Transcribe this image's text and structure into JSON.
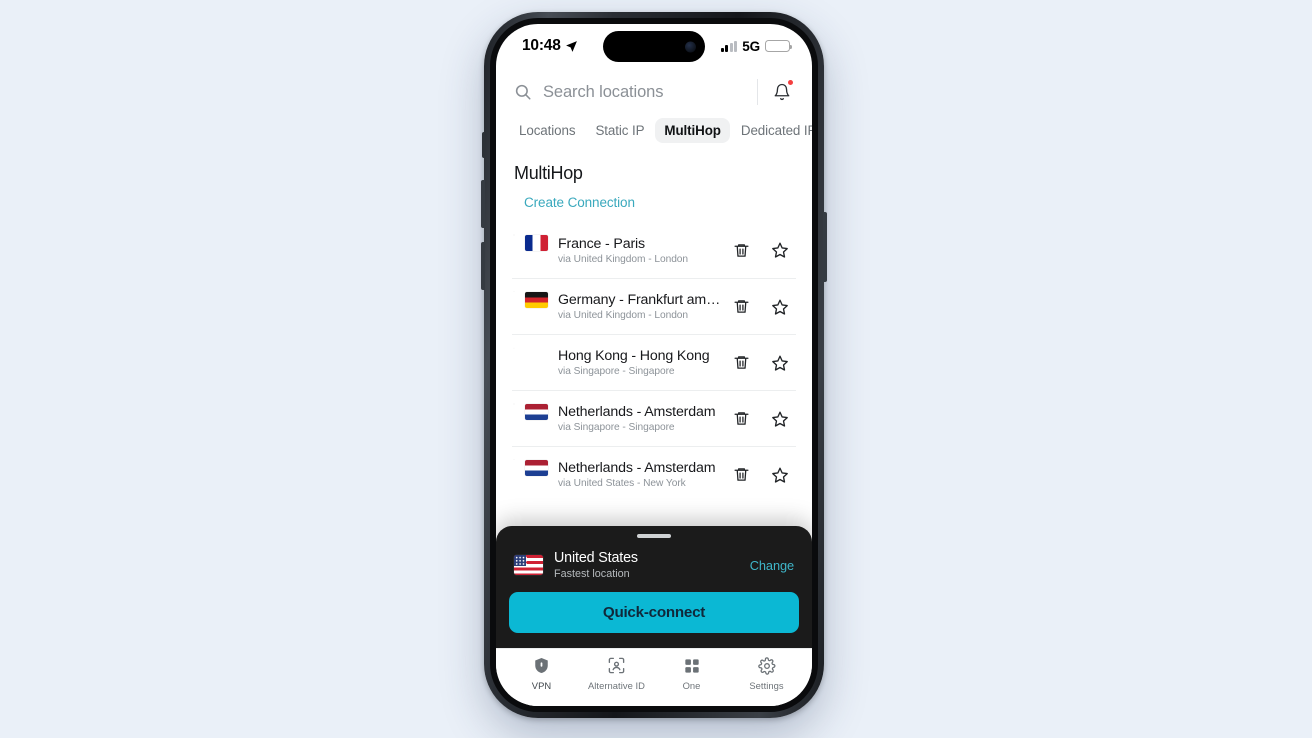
{
  "status_bar": {
    "time": "10:48",
    "location_icon": "location-arrow-icon",
    "network": "5G",
    "signal_icon": "cellular-signal-icon",
    "battery_icon": "battery-icon"
  },
  "search": {
    "icon": "search-icon",
    "placeholder": "Search locations",
    "value": "",
    "notifications_icon": "bell-icon",
    "has_notification_badge": true
  },
  "tabs": [
    {
      "label": "Locations",
      "active": false
    },
    {
      "label": "Static IP",
      "active": false
    },
    {
      "label": "MultiHop",
      "active": true
    },
    {
      "label": "Dedicated IP",
      "active": false
    }
  ],
  "page": {
    "title": "MultiHop",
    "create_link": "Create Connection"
  },
  "connections": [
    {
      "title": "France - Paris",
      "subtitle": "via United Kingdom - London",
      "flag_main": "f-fr",
      "flag_via": "f-gb",
      "delete_icon": "trash-icon",
      "favorite_icon": "star-icon"
    },
    {
      "title": "Germany - Frankfurt am Main",
      "subtitle": "via United Kingdom - London",
      "flag_main": "f-de",
      "flag_via": "f-gb",
      "delete_icon": "trash-icon",
      "favorite_icon": "star-icon"
    },
    {
      "title": "Hong Kong - Hong Kong",
      "subtitle": "via Singapore - Singapore",
      "flag_main": "f-hk",
      "flag_via": "f-sg",
      "delete_icon": "trash-icon",
      "favorite_icon": "star-icon"
    },
    {
      "title": "Netherlands - Amsterdam",
      "subtitle": "via Singapore - Singapore",
      "flag_main": "f-nl",
      "flag_via": "f-sg",
      "delete_icon": "trash-icon",
      "favorite_icon": "star-icon"
    },
    {
      "title": "Netherlands - Amsterdam",
      "subtitle": "via United States - New York",
      "flag_main": "f-nl",
      "flag_via": "f-us",
      "delete_icon": "trash-icon",
      "favorite_icon": "star-icon"
    }
  ],
  "sheet": {
    "grabber": "drag-handle",
    "country": "United States",
    "country_flag": "f-us",
    "subtitle": "Fastest location",
    "change_label": "Change",
    "connect_label": "Quick-connect"
  },
  "bottom_tabs": [
    {
      "label": "VPN",
      "icon": "shield-icon",
      "active": true
    },
    {
      "label": "Alternative ID",
      "icon": "alternative-id-icon",
      "active": false
    },
    {
      "label": "One",
      "icon": "grid-icon",
      "active": false
    },
    {
      "label": "Settings",
      "icon": "gear-icon",
      "active": false
    }
  ],
  "colors": {
    "accent_cyan": "#0bb8d4",
    "link_teal": "#3aa9bd",
    "page_background": "#eaf0f8",
    "sheet_background": "#1b1b1b",
    "notification_dot": "#f43f3f"
  }
}
